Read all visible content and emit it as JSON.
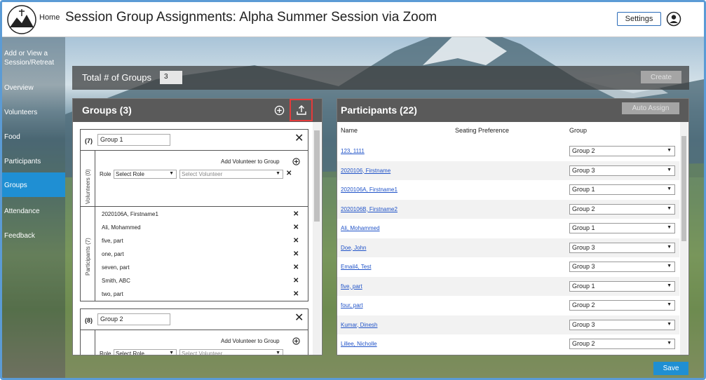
{
  "header": {
    "home": "Home",
    "title": "Session Group Assignments: Alpha Summer Session via Zoom",
    "settings": "Settings"
  },
  "sidebar": {
    "items": [
      {
        "label": "Add or View a Session/Retreat"
      },
      {
        "label": "Overview"
      },
      {
        "label": "Volunteers"
      },
      {
        "label": "Food"
      },
      {
        "label": "Participants"
      },
      {
        "label": "Groups",
        "active": true
      },
      {
        "label": "Attendance"
      },
      {
        "label": "Feedback"
      }
    ]
  },
  "total": {
    "label": "Total # of Groups",
    "value": "3",
    "create": "Create"
  },
  "groups": {
    "title": "Groups (3)",
    "add_volunteer": "Add Volunteer to Group",
    "role_label": "Role",
    "select_role": "Select Role",
    "select_volunteer": "Select Volunteer",
    "volunteers_label": "Volunteers (0)",
    "cards": [
      {
        "count": "(7)",
        "name": "Group 1",
        "participants_label": "Participants (7)",
        "participants": [
          "2020106A, Firstname1",
          "Ali, Mohammed",
          "five, part",
          "one, part",
          "seven, part",
          "Smith, ABC",
          "two, part"
        ]
      },
      {
        "count": "(8)",
        "name": "Group 2"
      }
    ]
  },
  "participants": {
    "title": "Participants (22)",
    "auto_assign": "Auto Assign",
    "columns": {
      "name": "Name",
      "seating": "Seating Preference",
      "group": "Group"
    },
    "rows": [
      {
        "name": "123, 1111",
        "group": "Group 2"
      },
      {
        "name": "2020106, Firstname",
        "group": "Group 3"
      },
      {
        "name": "2020106A, Firstname1",
        "group": "Group 1"
      },
      {
        "name": "2020106B, Firstname2",
        "group": "Group 2"
      },
      {
        "name": "Ali, Mohammed",
        "group": "Group 1"
      },
      {
        "name": "Doe, John",
        "group": "Group 3"
      },
      {
        "name": "Email4, Test",
        "group": "Group 3"
      },
      {
        "name": "five, part",
        "group": "Group 1"
      },
      {
        "name": "four, part",
        "group": "Group 2"
      },
      {
        "name": "Kumar, Dinesh",
        "group": "Group 3"
      },
      {
        "name": "Lillee, Nicholle",
        "group": "Group 2"
      }
    ]
  },
  "save": "Save",
  "colors": {
    "accent": "#1f8fd3",
    "panel_header": "#5a5a5a",
    "highlight": "#e53b3b",
    "link": "#2053c8"
  }
}
